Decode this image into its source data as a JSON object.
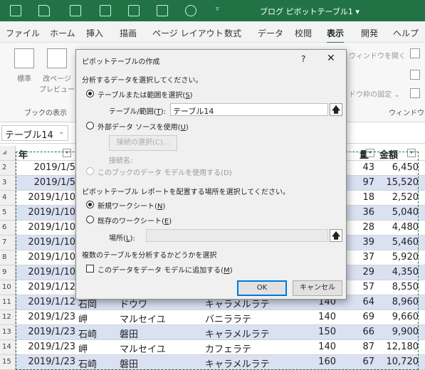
{
  "titlebar": {
    "title": "ブログ ピボットテーブル1 ▾"
  },
  "ribbon_tabs": [
    "ファイル",
    "ホーム",
    "挿入",
    "描画",
    "ページ レイアウト",
    "数式",
    "データ",
    "校閲",
    "表示",
    "開発",
    "ヘルプ"
  ],
  "active_tab": "表示",
  "ribbon": {
    "btn_normal": "標準",
    "btn_pagebreak": "改ページ\nプレビュー",
    "group_book_view": "ブックの表示",
    "new_window_partial": "ウィンドウを開く",
    "freeze_partial": "ドウ枠の固定 ⌄",
    "group_window": "ウィンドウ"
  },
  "namebox": {
    "value": "テーブル14"
  },
  "grid": {
    "header": {
      "c1": "年",
      "c5": "量",
      "c6": "金額"
    },
    "rows": [
      {
        "n": "2",
        "date": "2019/1/5",
        "loc": "",
        "item": "",
        "name": "",
        "price": "",
        "qty": "43",
        "amount": "6,450"
      },
      {
        "n": "3",
        "date": "2019/1/5",
        "loc": "",
        "item": "",
        "name": "",
        "price": "",
        "qty": "97",
        "amount": "15,520"
      },
      {
        "n": "4",
        "date": "2019/1/10",
        "loc": "",
        "item": "",
        "name": "",
        "price": "",
        "qty": "18",
        "amount": "2,520"
      },
      {
        "n": "5",
        "date": "2019/1/10",
        "loc": "",
        "item": "",
        "name": "",
        "price": "",
        "qty": "36",
        "amount": "5,040"
      },
      {
        "n": "6",
        "date": "2019/1/10",
        "loc": "",
        "item": "",
        "name": "",
        "price": "",
        "qty": "28",
        "amount": "4,480"
      },
      {
        "n": "7",
        "date": "2019/1/10",
        "loc": "",
        "item": "",
        "name": "",
        "price": "",
        "qty": "39",
        "amount": "5,460"
      },
      {
        "n": "8",
        "date": "2019/1/10",
        "loc": "",
        "item": "",
        "name": "",
        "price": "",
        "qty": "37",
        "amount": "5,920"
      },
      {
        "n": "9",
        "date": "2019/1/10",
        "loc": "",
        "item": "",
        "name": "",
        "price": "",
        "qty": "29",
        "amount": "4,350"
      },
      {
        "n": "10",
        "date": "2019/1/12",
        "loc": "",
        "item": "",
        "name": "",
        "price": "",
        "qty": "57",
        "amount": "8,550"
      },
      {
        "n": "11",
        "date": "2019/1/12",
        "loc": "石岡",
        "item": "ドウワ",
        "name": "キャラメルラテ",
        "price": "140",
        "qty": "64",
        "amount": "8,960"
      },
      {
        "n": "12",
        "date": "2019/1/23",
        "loc": "岬",
        "item": "マルセイユ",
        "name": "バニララテ",
        "price": "140",
        "qty": "69",
        "amount": "9,660"
      },
      {
        "n": "13",
        "date": "2019/1/23",
        "loc": "石崎",
        "item": "磐田",
        "name": "キャラメルラテ",
        "price": "150",
        "qty": "66",
        "amount": "9,900"
      },
      {
        "n": "14",
        "date": "2019/1/23",
        "loc": "岬",
        "item": "マルセイユ",
        "name": "カフェラテ",
        "price": "140",
        "qty": "87",
        "amount": "12,180"
      },
      {
        "n": "15",
        "date": "2019/1/23",
        "loc": "石崎",
        "item": "磐田",
        "name": "キャラメルラテ",
        "price": "160",
        "qty": "67",
        "amount": "10,720"
      }
    ]
  },
  "dialog": {
    "title": "ピボットテーブルの作成",
    "help": "?",
    "close": "✕",
    "section1": "分析するデータを選択してください。",
    "opt_table": "テーブルまたは範囲を選択(",
    "opt_table_key": "S",
    "range_label": "テーブル/範囲(",
    "range_label_key": "T",
    "range_value": "テーブル14",
    "opt_external": "外部データ ソースを使用(",
    "opt_external_key": "U",
    "choose_conn": "接続の選択(C)...",
    "conn_name_label": "接続名:",
    "opt_datamodel": "このブックのデータ モデルを使用する(D)",
    "section2": "ピボットテーブル レポートを配置する場所を選択してください。",
    "opt_new_sheet": "新規ワークシート(",
    "opt_new_sheet_key": "N",
    "opt_existing_sheet": "既存のワークシート(",
    "opt_existing_sheet_key": "E",
    "location_label": "場所(",
    "location_label_key": "L",
    "location_value": "",
    "section3": "複数のテーブルを分析するかどうかを選択",
    "add_model": "このデータをデータ モデルに追加する(",
    "add_model_key": "M",
    "ok": "OK",
    "cancel": "キャンセル",
    "arrow_glyph": "🡅"
  }
}
